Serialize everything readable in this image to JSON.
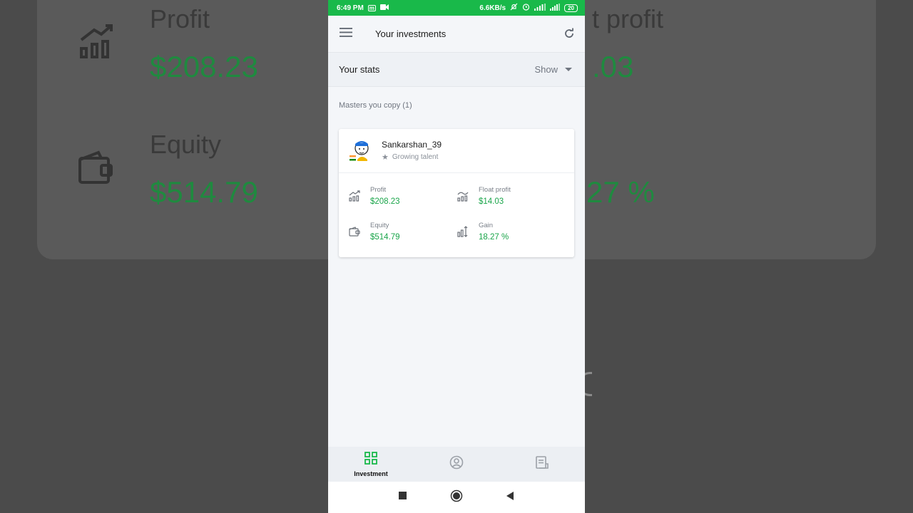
{
  "background": {
    "profit_label": "Profit",
    "profit_value": "$208.23",
    "equity_label": "Equity",
    "equity_value": "$514.79",
    "float_label_partial": "t profit",
    "float_value_partial": ".03",
    "gain_value_partial": "27 %"
  },
  "statusbar": {
    "time": "6:49 PM",
    "speed": "6.6KB/s",
    "battery": "20"
  },
  "appbar": {
    "title": "Your investments",
    "menu_icon": "hamburger-menu-icon",
    "refresh_icon": "refresh-icon"
  },
  "stats": {
    "label": "Your stats",
    "toggle_label": "Show"
  },
  "masters": {
    "section_title": "Masters you copy (1)",
    "items": [
      {
        "name": "Sankarshan_39",
        "rank": "Growing talent",
        "metrics": {
          "profit_label": "Profit",
          "profit_value": "$208.23",
          "float_label": "Float profit",
          "float_value": "$14.03",
          "equity_label": "Equity",
          "equity_value": "$514.79",
          "gain_label": "Gain",
          "gain_value": "18.27 %"
        }
      }
    ]
  },
  "bottomnav": {
    "items": [
      {
        "label": "Investment",
        "icon": "grid-icon",
        "active": true
      },
      {
        "label": "",
        "icon": "profile-icon",
        "active": false
      },
      {
        "label": "",
        "icon": "history-icon",
        "active": false
      }
    ]
  },
  "colors": {
    "accent": "#19b94a",
    "value_green": "#1aa54a"
  }
}
